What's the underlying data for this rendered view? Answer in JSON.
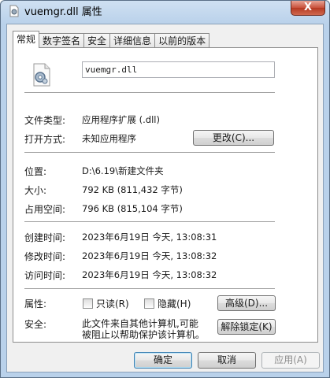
{
  "window": {
    "title": "vuemgr.dll 属性",
    "close_glyph": "X"
  },
  "tabs": [
    {
      "label": "常规",
      "active": true
    },
    {
      "label": "数字签名",
      "active": false
    },
    {
      "label": "安全",
      "active": false
    },
    {
      "label": "详细信息",
      "active": false
    },
    {
      "label": "以前的版本",
      "active": false
    }
  ],
  "general": {
    "file_name": "vuemgr.dll",
    "file_type_label": "文件类型:",
    "file_type_value": "应用程序扩展 (.dll)",
    "opens_with_label": "打开方式:",
    "opens_with_value": "未知应用程序",
    "change_button": "更改(C)...",
    "location_label": "位置:",
    "location_value": "D:\\6.19\\新建文件夹",
    "size_label": "大小:",
    "size_value": "792 KB (811,432 字节)",
    "size_on_disk_label": "占用空间:",
    "size_on_disk_value": "796 KB (815,104 字节)",
    "created_label": "创建时间:",
    "created_value": "2023年6月19日 今天, 13:08:31",
    "modified_label": "修改时间:",
    "modified_value": "2023年6月19日 今天, 13:08:32",
    "accessed_label": "访问时间:",
    "accessed_value": "2023年6月19日 今天, 13:08:32",
    "attributes_label": "属性:",
    "readonly_label": "只读(R)",
    "readonly_checked": false,
    "hidden_label": "隐藏(H)",
    "hidden_checked": false,
    "advanced_button": "高级(D)...",
    "security_label": "安全:",
    "security_text_line1": "此文件来自其他计算机,可能",
    "security_text_line2": "被阻止以帮助保护该计算机。",
    "unblock_button": "解除锁定(K)"
  },
  "footer": {
    "ok_button": "确定",
    "cancel_button": "取消",
    "apply_button": "应用(A)"
  }
}
